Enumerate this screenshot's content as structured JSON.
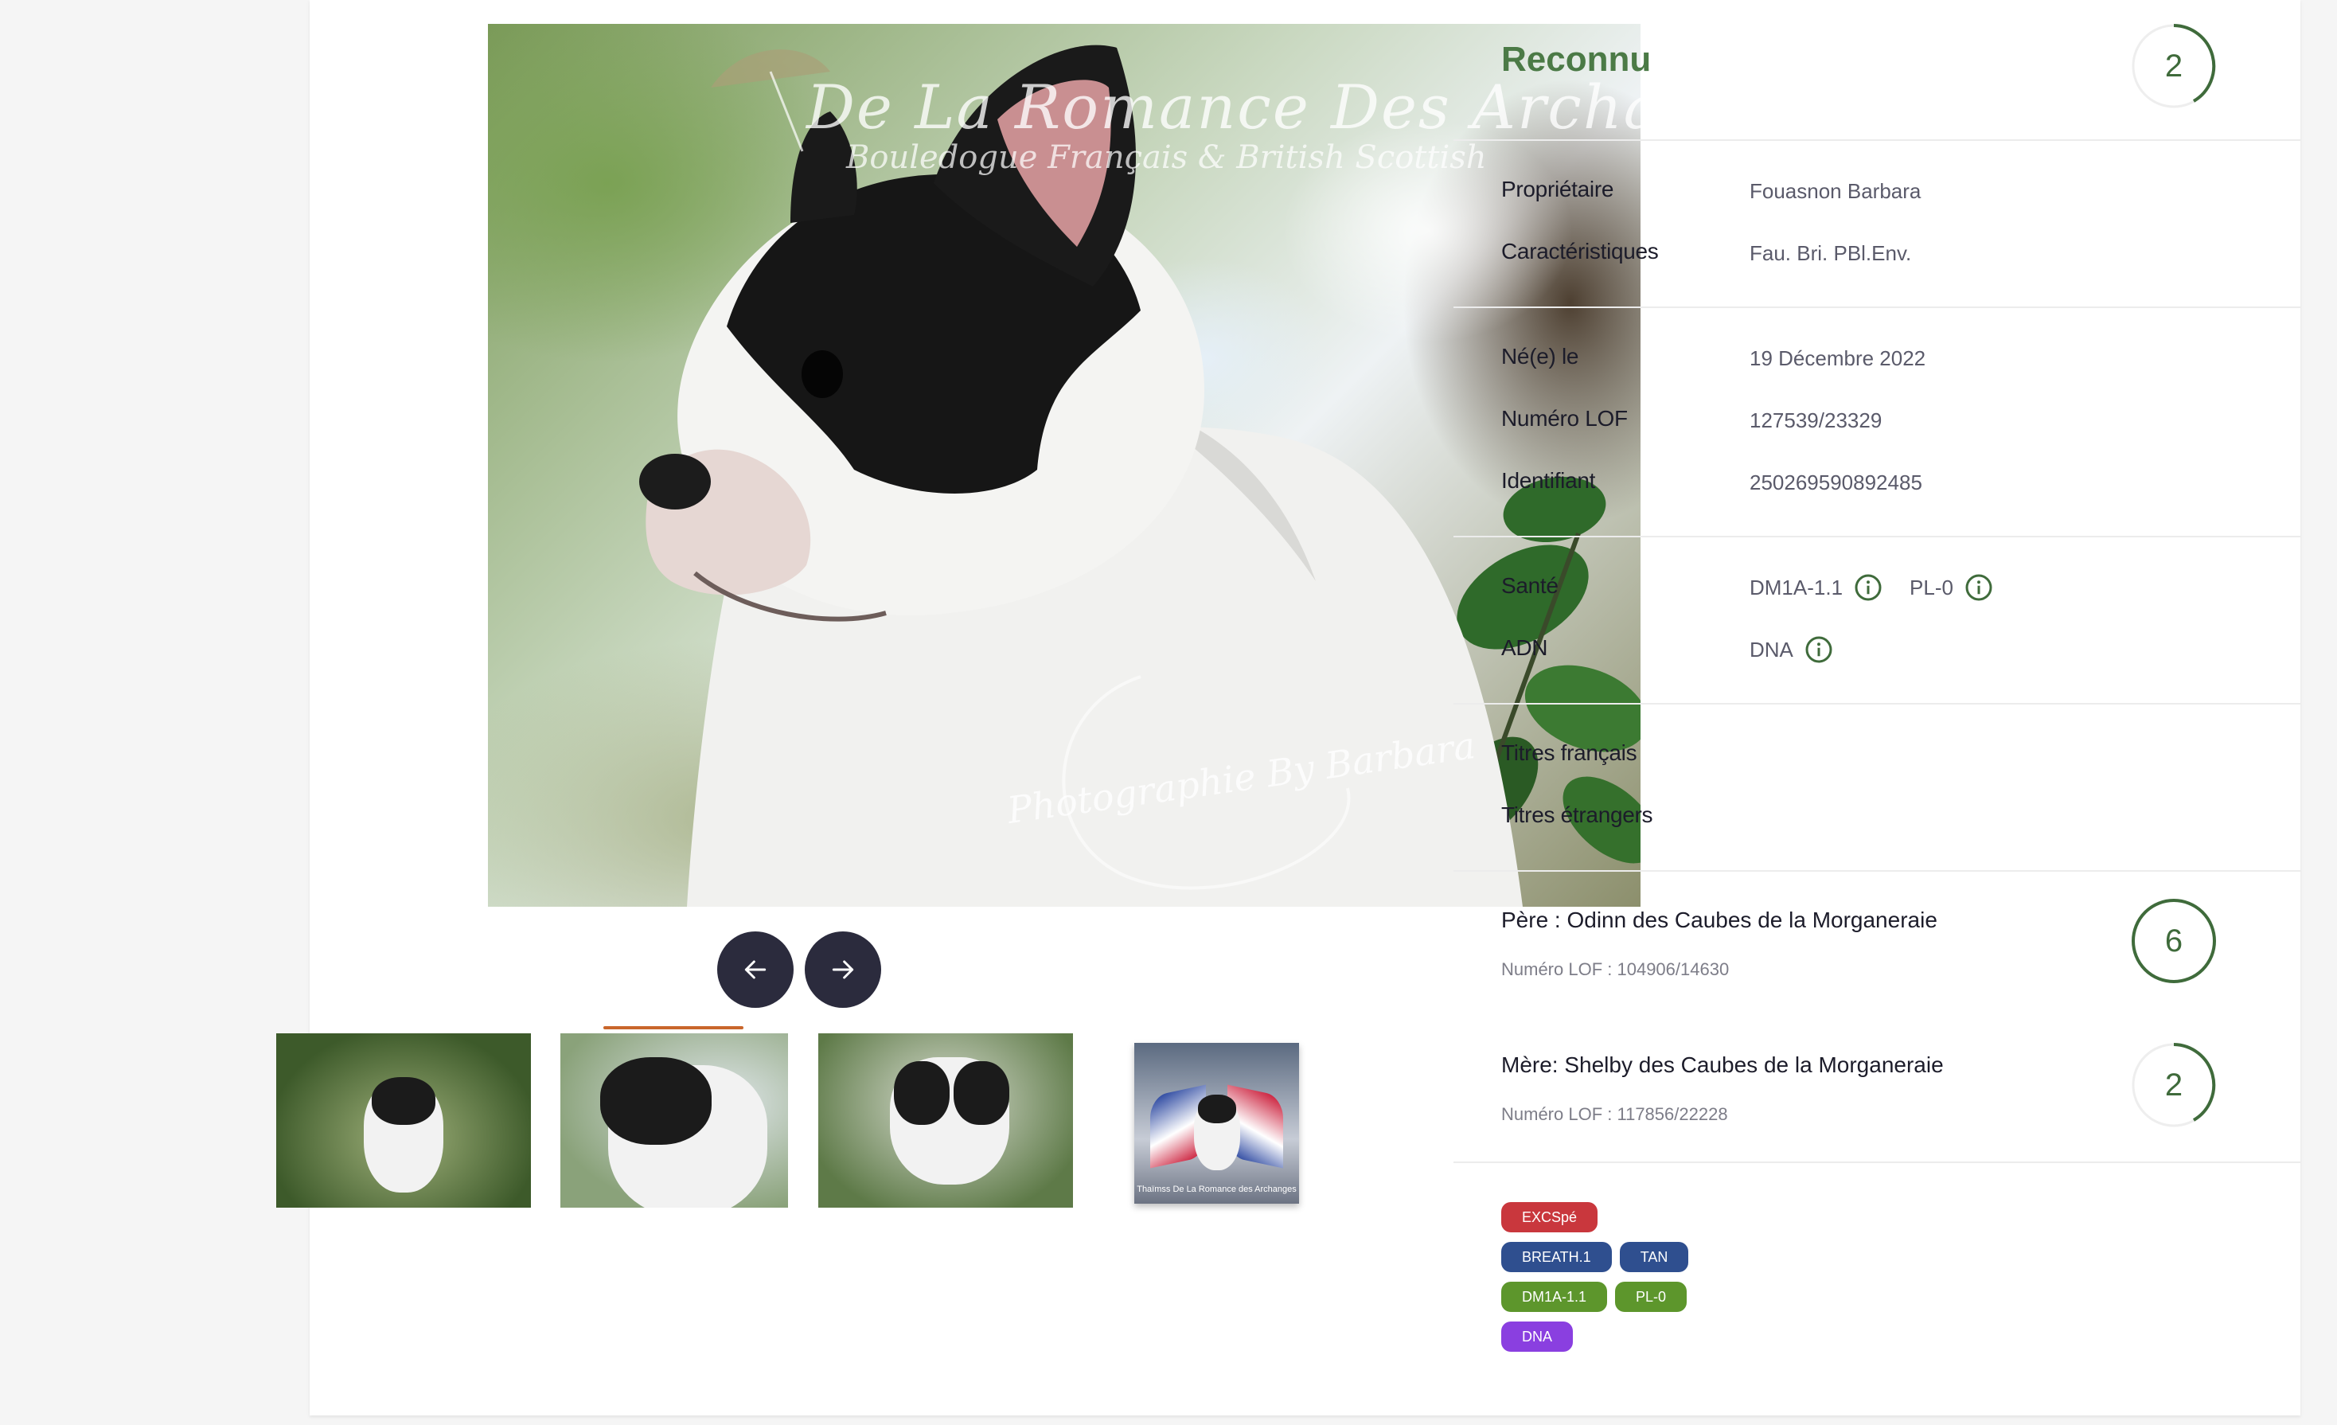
{
  "photo": {
    "watermark_title": "De La Romance Des Archanges",
    "watermark_subtitle": "Bouledogue Français & British Scottish",
    "watermark_credit": "Photographie By Barbara"
  },
  "thumbnails": {
    "caption_4": "Thaïmss De La Romance des Archanges"
  },
  "status": {
    "title": "Reconnu",
    "level": "2"
  },
  "owner_section": {
    "rows": [
      {
        "label": "Propriétaire",
        "value": "Fouasnon Barbara"
      },
      {
        "label": "Caractéristiques",
        "value": "Fau. Bri. PBl.Env."
      }
    ]
  },
  "identity_section": {
    "rows": [
      {
        "label": "Né(e) le",
        "value": "19 Décembre 2022"
      },
      {
        "label": "Numéro LOF",
        "value": "127539/23329"
      },
      {
        "label": "Identifiant",
        "value": "250269590892485"
      }
    ]
  },
  "health_section": {
    "health_label": "Santé",
    "health_tests": [
      "DM1A-1.1",
      "PL-0"
    ],
    "dna_label": "ADN",
    "dna_tests": [
      "DNA"
    ]
  },
  "titles_section": {
    "french_label": "Titres français",
    "foreign_label": "Titres étrangers"
  },
  "parents": {
    "father": {
      "name": "Père : Odinn des Caubes de la Morganeraie",
      "lof": "Numéro LOF : 104906/14630",
      "level": "6"
    },
    "mother": {
      "name": "Mère: Shelby des Caubes de la Morganeraie",
      "lof": "Numéro LOF : 117856/22228",
      "level": "2"
    }
  },
  "badges": {
    "rows": [
      [
        {
          "text": "EXCSpé",
          "color": "#c9373d"
        }
      ],
      [
        {
          "text": "BREATH.1",
          "color": "#2f4f8f"
        },
        {
          "text": "TAN",
          "color": "#2f4f8f"
        }
      ],
      [
        {
          "text": "DM1A-1.1",
          "color": "#5d962c"
        },
        {
          "text": "PL-0",
          "color": "#5d962c"
        }
      ],
      [
        {
          "text": "DNA",
          "color": "#8a3fe0"
        }
      ]
    ]
  },
  "colors": {
    "accent_green": "#4b7a46",
    "nav_button": "#2b2b3d"
  }
}
